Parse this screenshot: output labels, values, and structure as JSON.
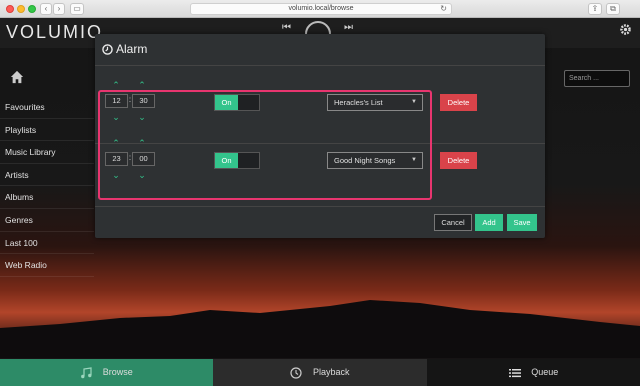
{
  "browser": {
    "url": "volumio.local/browse",
    "back_glyph": "‹",
    "forward_glyph": "›",
    "sidebar_glyph": "▭",
    "reload_glyph": "↻",
    "share_glyph": "⇪",
    "tabs_glyph": "⧉"
  },
  "app": {
    "logo": "VOLUMIO",
    "search_placeholder": "Search ..."
  },
  "transport": {
    "prev_glyph": "⏮",
    "next_glyph": "⏭"
  },
  "sidebar": {
    "items": [
      {
        "label": "Favourites"
      },
      {
        "label": "Playlists"
      },
      {
        "label": "Music Library"
      },
      {
        "label": "Artists"
      },
      {
        "label": "Albums"
      },
      {
        "label": "Genres"
      },
      {
        "label": "Last 100"
      },
      {
        "label": "Web Radio"
      }
    ]
  },
  "modal": {
    "title": "Alarm",
    "alarms": [
      {
        "hour": "12",
        "minute": "30",
        "enabled_label": "On",
        "playlist": "Heracles's List",
        "delete_label": "Delete"
      },
      {
        "hour": "23",
        "minute": "00",
        "enabled_label": "On",
        "playlist": "Good Night Songs",
        "delete_label": "Delete"
      }
    ],
    "time_separator": ":",
    "up_glyph": "⌃",
    "down_glyph": "⌄",
    "caret_glyph": "▼",
    "cancel_label": "Cancel",
    "add_label": "Add",
    "save_label": "Save"
  },
  "bottom": {
    "tabs": [
      {
        "label": "Browse",
        "icon": "music-note-icon"
      },
      {
        "label": "Playback",
        "icon": "clock-icon"
      },
      {
        "label": "Queue",
        "icon": "list-icon"
      }
    ]
  },
  "colors": {
    "accent": "#33c48c",
    "delete": "#d9434a",
    "highlight": "#e8356f",
    "browse_tab": "#2d8b67"
  }
}
